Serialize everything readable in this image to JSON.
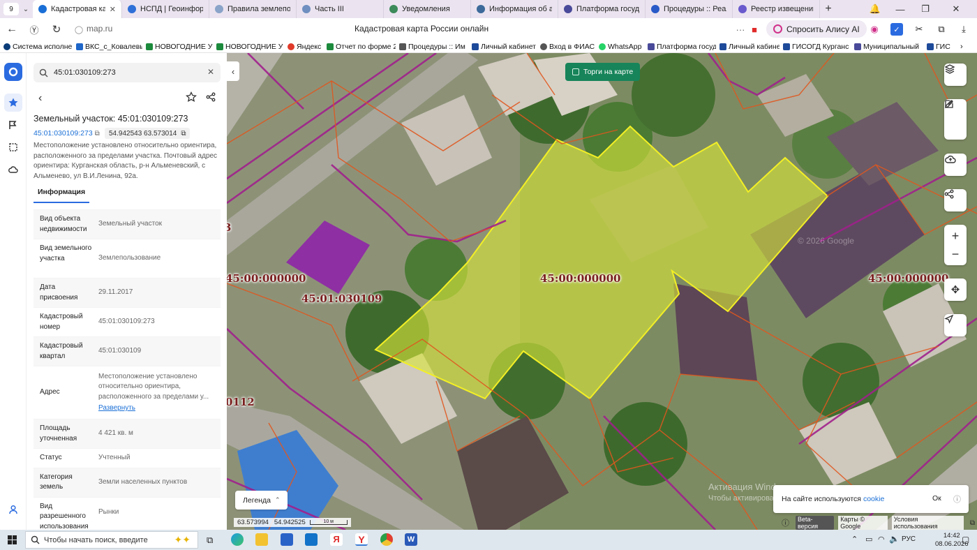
{
  "browser": {
    "tab_count": "9",
    "tabs": [
      {
        "label": "Кадастровая карт",
        "color": "#1a6fd6",
        "active": true
      },
      {
        "label": "НСПД | Геоинформа",
        "color": "#2f6fd8"
      },
      {
        "label": "Правила землепольз",
        "color": "#8aa3c8"
      },
      {
        "label": "Часть III",
        "color": "#6f8fc0"
      },
      {
        "label": "Уведомления",
        "color": "#3d8a5a"
      },
      {
        "label": "Информация об адр",
        "color": "#3d6a9a"
      },
      {
        "label": "Платформа государс",
        "color": "#4a4a9a"
      },
      {
        "label": "Процедуры :: Реали",
        "color": "#2a5ac8"
      },
      {
        "label": "Реестр извещений",
        "color": "#6a5acd"
      }
    ],
    "url": "map.ru",
    "page_title": "Кадастровая карта России онлайн",
    "alice_label": "Спросить Алису AI",
    "bookmarks": [
      {
        "label": "Система исполне",
        "color": "#0a3c78"
      },
      {
        "label": "ВКС_с_Ковалевым",
        "color": "#1e66c8"
      },
      {
        "label": "НОВОГОДНИЕ У",
        "color": "#1c8a3c"
      },
      {
        "label": "НОВОГОДНИЕ У",
        "color": "#1c8a3c"
      },
      {
        "label": "Яндекс",
        "color": "#e03a2a"
      },
      {
        "label": "Отчет по форме 2",
        "color": "#1c8a3c"
      },
      {
        "label": "Процедуры :: Им",
        "color": "#555555"
      },
      {
        "label": "Личный кабинет",
        "color": "#1e4a9a"
      },
      {
        "label": "Вход в ФИАС",
        "color": "#555555"
      },
      {
        "label": "WhatsApp",
        "color": "#25d366"
      },
      {
        "label": "Платформа госуд",
        "color": "#4a4a9a"
      },
      {
        "label": "Личный кабинет",
        "color": "#1e4a9a"
      },
      {
        "label": "ГИСОГД Курганс",
        "color": "#1e4a9a"
      },
      {
        "label": "Муниципальный",
        "color": "#4a4a9a"
      },
      {
        "label": "ГИС",
        "color": "#1e4a9a"
      }
    ]
  },
  "panel": {
    "search_value": "45:01:030109:273",
    "title": "Земельный участок: 45:01:030109:273",
    "cad_number_link": "45:01:030109:273",
    "coords": "54.942543 63.573014",
    "location_description": "Местоположение установлено относительно ориентира, расположенного за пределами участка. Почтовый адрес ориентира: Курганская область, р-н Альменевский, с Альменево, ул В.И.Ленина, 92а.",
    "info_tab": "Информация",
    "properties": [
      {
        "key": "Вид объекта недвижимости",
        "value": "Земельный участок"
      },
      {
        "key": "Вид земельного участка",
        "value": "Землепользование"
      },
      {
        "key": "Дата присвоения",
        "value": "29.11.2017"
      },
      {
        "key": "Кадастровый номер",
        "value": "45:01:030109:273"
      },
      {
        "key": "Кадастровый квартал",
        "value": "45:01:030109"
      },
      {
        "key": "Адрес",
        "value": "Местоположение установлено относительно ориентира, расположенного за пределами у...",
        "link": "Развернуть"
      },
      {
        "key": "Площадь уточненная",
        "value": "4 421 кв. м"
      },
      {
        "key": "Статус",
        "value": "Учтенный"
      },
      {
        "key": "Категория земель",
        "value": "Земли населенных пунктов"
      },
      {
        "key": "Вид разрешенного использования",
        "value": "Рынки"
      }
    ]
  },
  "map": {
    "torgi_label": "Торги на карте",
    "labels": [
      {
        "text": "45:00:000000"
      },
      {
        "text": "45:01:030109"
      },
      {
        "text": "45:00:000000"
      },
      {
        "text": "45:00:000000"
      },
      {
        "text": "0112"
      },
      {
        "text": "3"
      }
    ],
    "legend_label": "Легенда",
    "cursor_coords": "63.573994   54.942525",
    "scale_label": "10 м",
    "beta": "Beta-версия",
    "maps_credit": "Карты © Google",
    "terms": "Условия использования",
    "cookie_text": "На сайте используются",
    "cookie_link": "cookie",
    "cookie_ok": "Ок",
    "watermark_line1": "Активация Windows",
    "watermark_line2": "Чтобы активировать Windows, перейдите в раздел \"Параметры\"",
    "imagery_credit": "© 2026 Google"
  },
  "taskbar": {
    "search_placeholder": "Чтобы начать поиск, введите",
    "lang": "РУС",
    "time": "14:42",
    "date": "08.06.2026"
  }
}
